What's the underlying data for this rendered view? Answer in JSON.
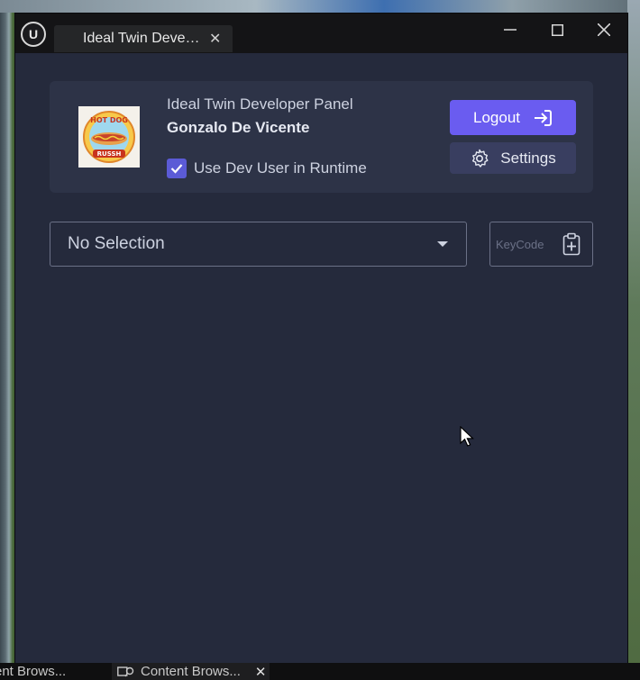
{
  "window": {
    "tab_title": "Ideal Twin Deve…",
    "tab_close": "✕",
    "controls": {
      "minimize": "minimize-icon",
      "maximize": "maximize-icon",
      "close": "close-icon"
    }
  },
  "header": {
    "panel_title": "Ideal Twin Developer Panel",
    "user_name": "Gonzalo De Vicente",
    "use_dev_user": {
      "label": "Use Dev User in Runtime",
      "checked": true
    },
    "logout_label": "Logout",
    "settings_label": "Settings",
    "avatar": {
      "line1": "HOT DOG",
      "line2": "RUSSH"
    }
  },
  "selection": {
    "value": "No Selection"
  },
  "keycode": {
    "placeholder": "KeyCode"
  },
  "taskbar": {
    "items": [
      {
        "label": "ent Brows..."
      },
      {
        "label": "Content Brows...",
        "close": "✕"
      }
    ]
  },
  "colors": {
    "window_bg": "#252a3c",
    "card_bg": "#2d3347",
    "accent": "#6a5cf0",
    "settings_bg": "#393e60",
    "checkbox": "#5b5bd6"
  }
}
